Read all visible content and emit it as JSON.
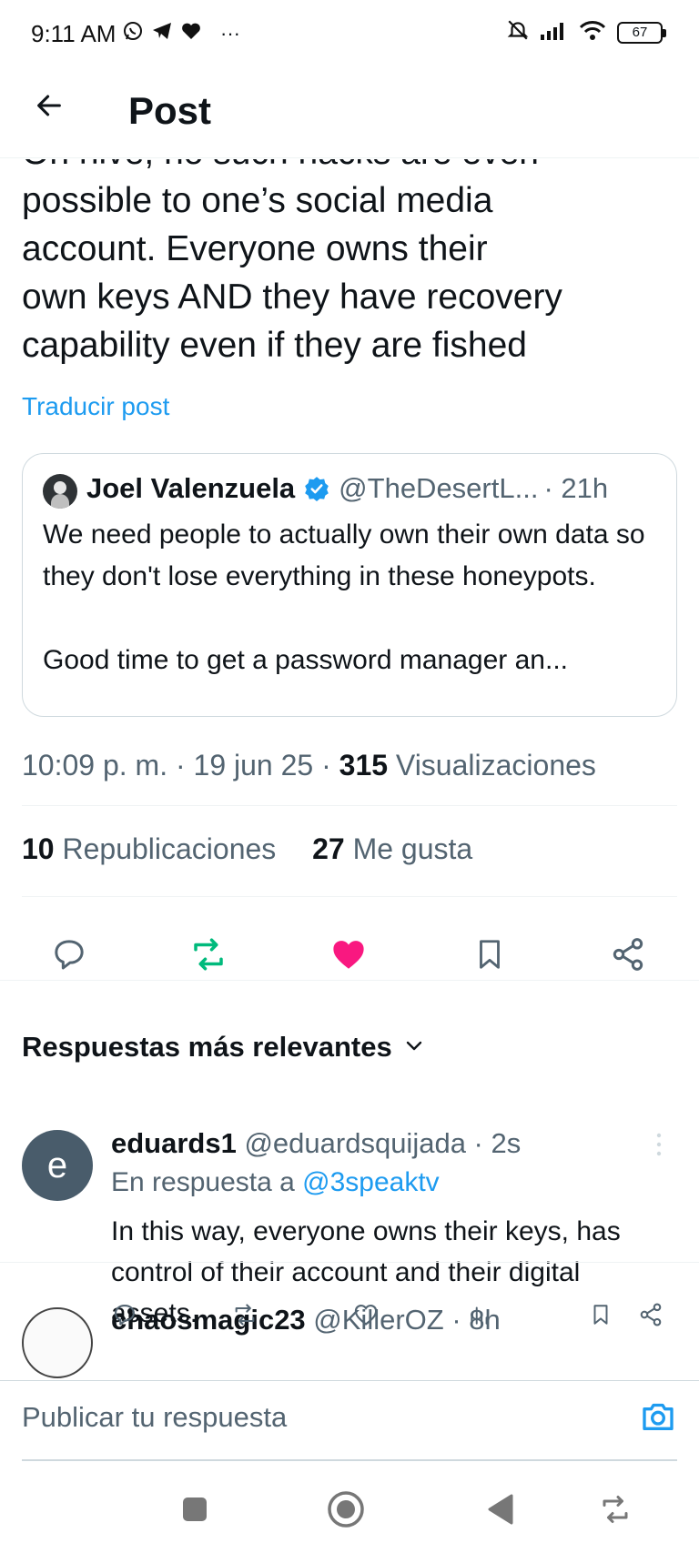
{
  "status_bar": {
    "time": "9:11 AM",
    "more": "···",
    "battery": "67"
  },
  "header": {
    "title": "Post"
  },
  "post": {
    "lines": [
      "On hive, no such hacks are even",
      "possible to one’s social media",
      "account.  Everyone owns their",
      "own keys AND they have recovery",
      "capability even if they are fished"
    ],
    "translate_label": "Traducir post",
    "quoted": {
      "name": "Joel Valenzuela",
      "handle": "@TheDesertL...",
      "time": "· 21h",
      "text_p1": "We need people to actually own their own data so they don't lose everything in these honeypots.",
      "text_p2": "Good time to get a password manager an..."
    },
    "timestamp": "10:09 p. m. · 19 jun 25 · ",
    "views_count": "315",
    "views_label": " Visualizaciones",
    "reposts_count": "10",
    "reposts_label": " Republicaciones",
    "likes_count": "27",
    "likes_label": " Me gusta"
  },
  "colors": {
    "accent": "#1d9bf0",
    "repost_active": "#00ba7c",
    "like_active": "#f91880",
    "secondary_text": "#536471"
  },
  "replies_sort": {
    "label": "Respuestas más relevantes"
  },
  "replies": [
    {
      "avatar_letter": "e",
      "name": "eduards1",
      "handle": " @eduardsquijada",
      "time": " · 2s",
      "reply_to_prefix": "En respuesta a ",
      "reply_to_mention": "@3speaktv",
      "text": "In this way, everyone owns their keys, has control of their account and their digital assets."
    },
    {
      "name": "chaosmagic23",
      "handle": " @KillerOZ",
      "time": " · 8h"
    }
  ],
  "composer": {
    "placeholder": "Publicar tu respuesta"
  },
  "icons": {
    "whatsapp": "whatsapp-icon",
    "telegram": "telegram-icon",
    "heart": "heart-icon",
    "mute": "bell-off-icon",
    "signal": "signal-icon",
    "wifi": "wifi-icon",
    "battery": "battery-icon",
    "back": "arrow-left-icon",
    "verified": "verified-badge-icon",
    "reply": "comment-icon",
    "repost": "repost-icon",
    "like": "heart-icon",
    "bookmark": "bookmark-icon",
    "share": "share-icon",
    "views": "bar-chart-icon",
    "more": "more-vertical-icon",
    "camera": "camera-icon",
    "nav_recents": "square-icon",
    "nav_home": "circle-icon",
    "nav_back": "triangle-back-icon",
    "nav_rotate": "rotate-icon",
    "chevron": "chevron-down-icon"
  }
}
